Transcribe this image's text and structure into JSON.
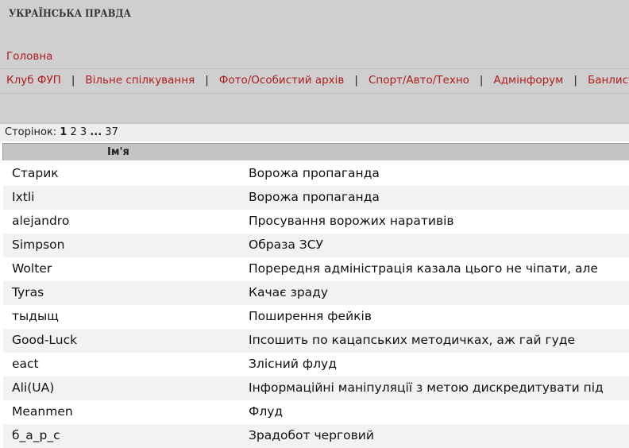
{
  "header": {
    "logo_text": "УКРАЇНСЬКА ПРАВДА",
    "home_link": "Головна",
    "forums": [
      {
        "label": "Клуб ФУП"
      },
      {
        "label": "Вільне спілкування"
      },
      {
        "label": "Фото/Особистий архів"
      },
      {
        "label": "Спорт/Авто/Техно"
      },
      {
        "label": "Адмінфорум"
      },
      {
        "label": "Банлист"
      }
    ],
    "separator": "|"
  },
  "pager": {
    "label": "Сторінок:",
    "pages": [
      "1",
      "2",
      "3"
    ],
    "ellipsis": "...",
    "last_page": "37",
    "current": "1"
  },
  "table": {
    "column_name_header": "Ім'я",
    "rows": [
      {
        "name": "Старик",
        "reason": "Ворожа пропаганда"
      },
      {
        "name": "Ixtli",
        "reason": "Ворожа пропаганда"
      },
      {
        "name": "alejandro",
        "reason": "Просування ворожих наративів"
      },
      {
        "name": "Simpson",
        "reason": "Образа ЗСУ"
      },
      {
        "name": "Wolter",
        "reason": "Порередня адміністрація казала цього не чіпати, але"
      },
      {
        "name": "Tyras",
        "reason": "Качає зраду"
      },
      {
        "name": "тыдыщ",
        "reason": "Поширення фейків"
      },
      {
        "name": "Good-Luck",
        "reason": "Іпсошить по кацапських методичках, аж гай гуде"
      },
      {
        "name": "eact",
        "reason": "Злісний флуд"
      },
      {
        "name": "Ali(UA)",
        "reason": "Інформаційні маніпуляції з метою дискредитувати під"
      },
      {
        "name": "Meanmen",
        "reason": "Флуд"
      },
      {
        "name": "б_а_р_с",
        "reason": "Зрадобот черговий"
      }
    ]
  },
  "colors": {
    "link_red": "#b01c1c",
    "header_bg": "#cfcfcf",
    "row_alt_bg": "#f2f2f2"
  }
}
